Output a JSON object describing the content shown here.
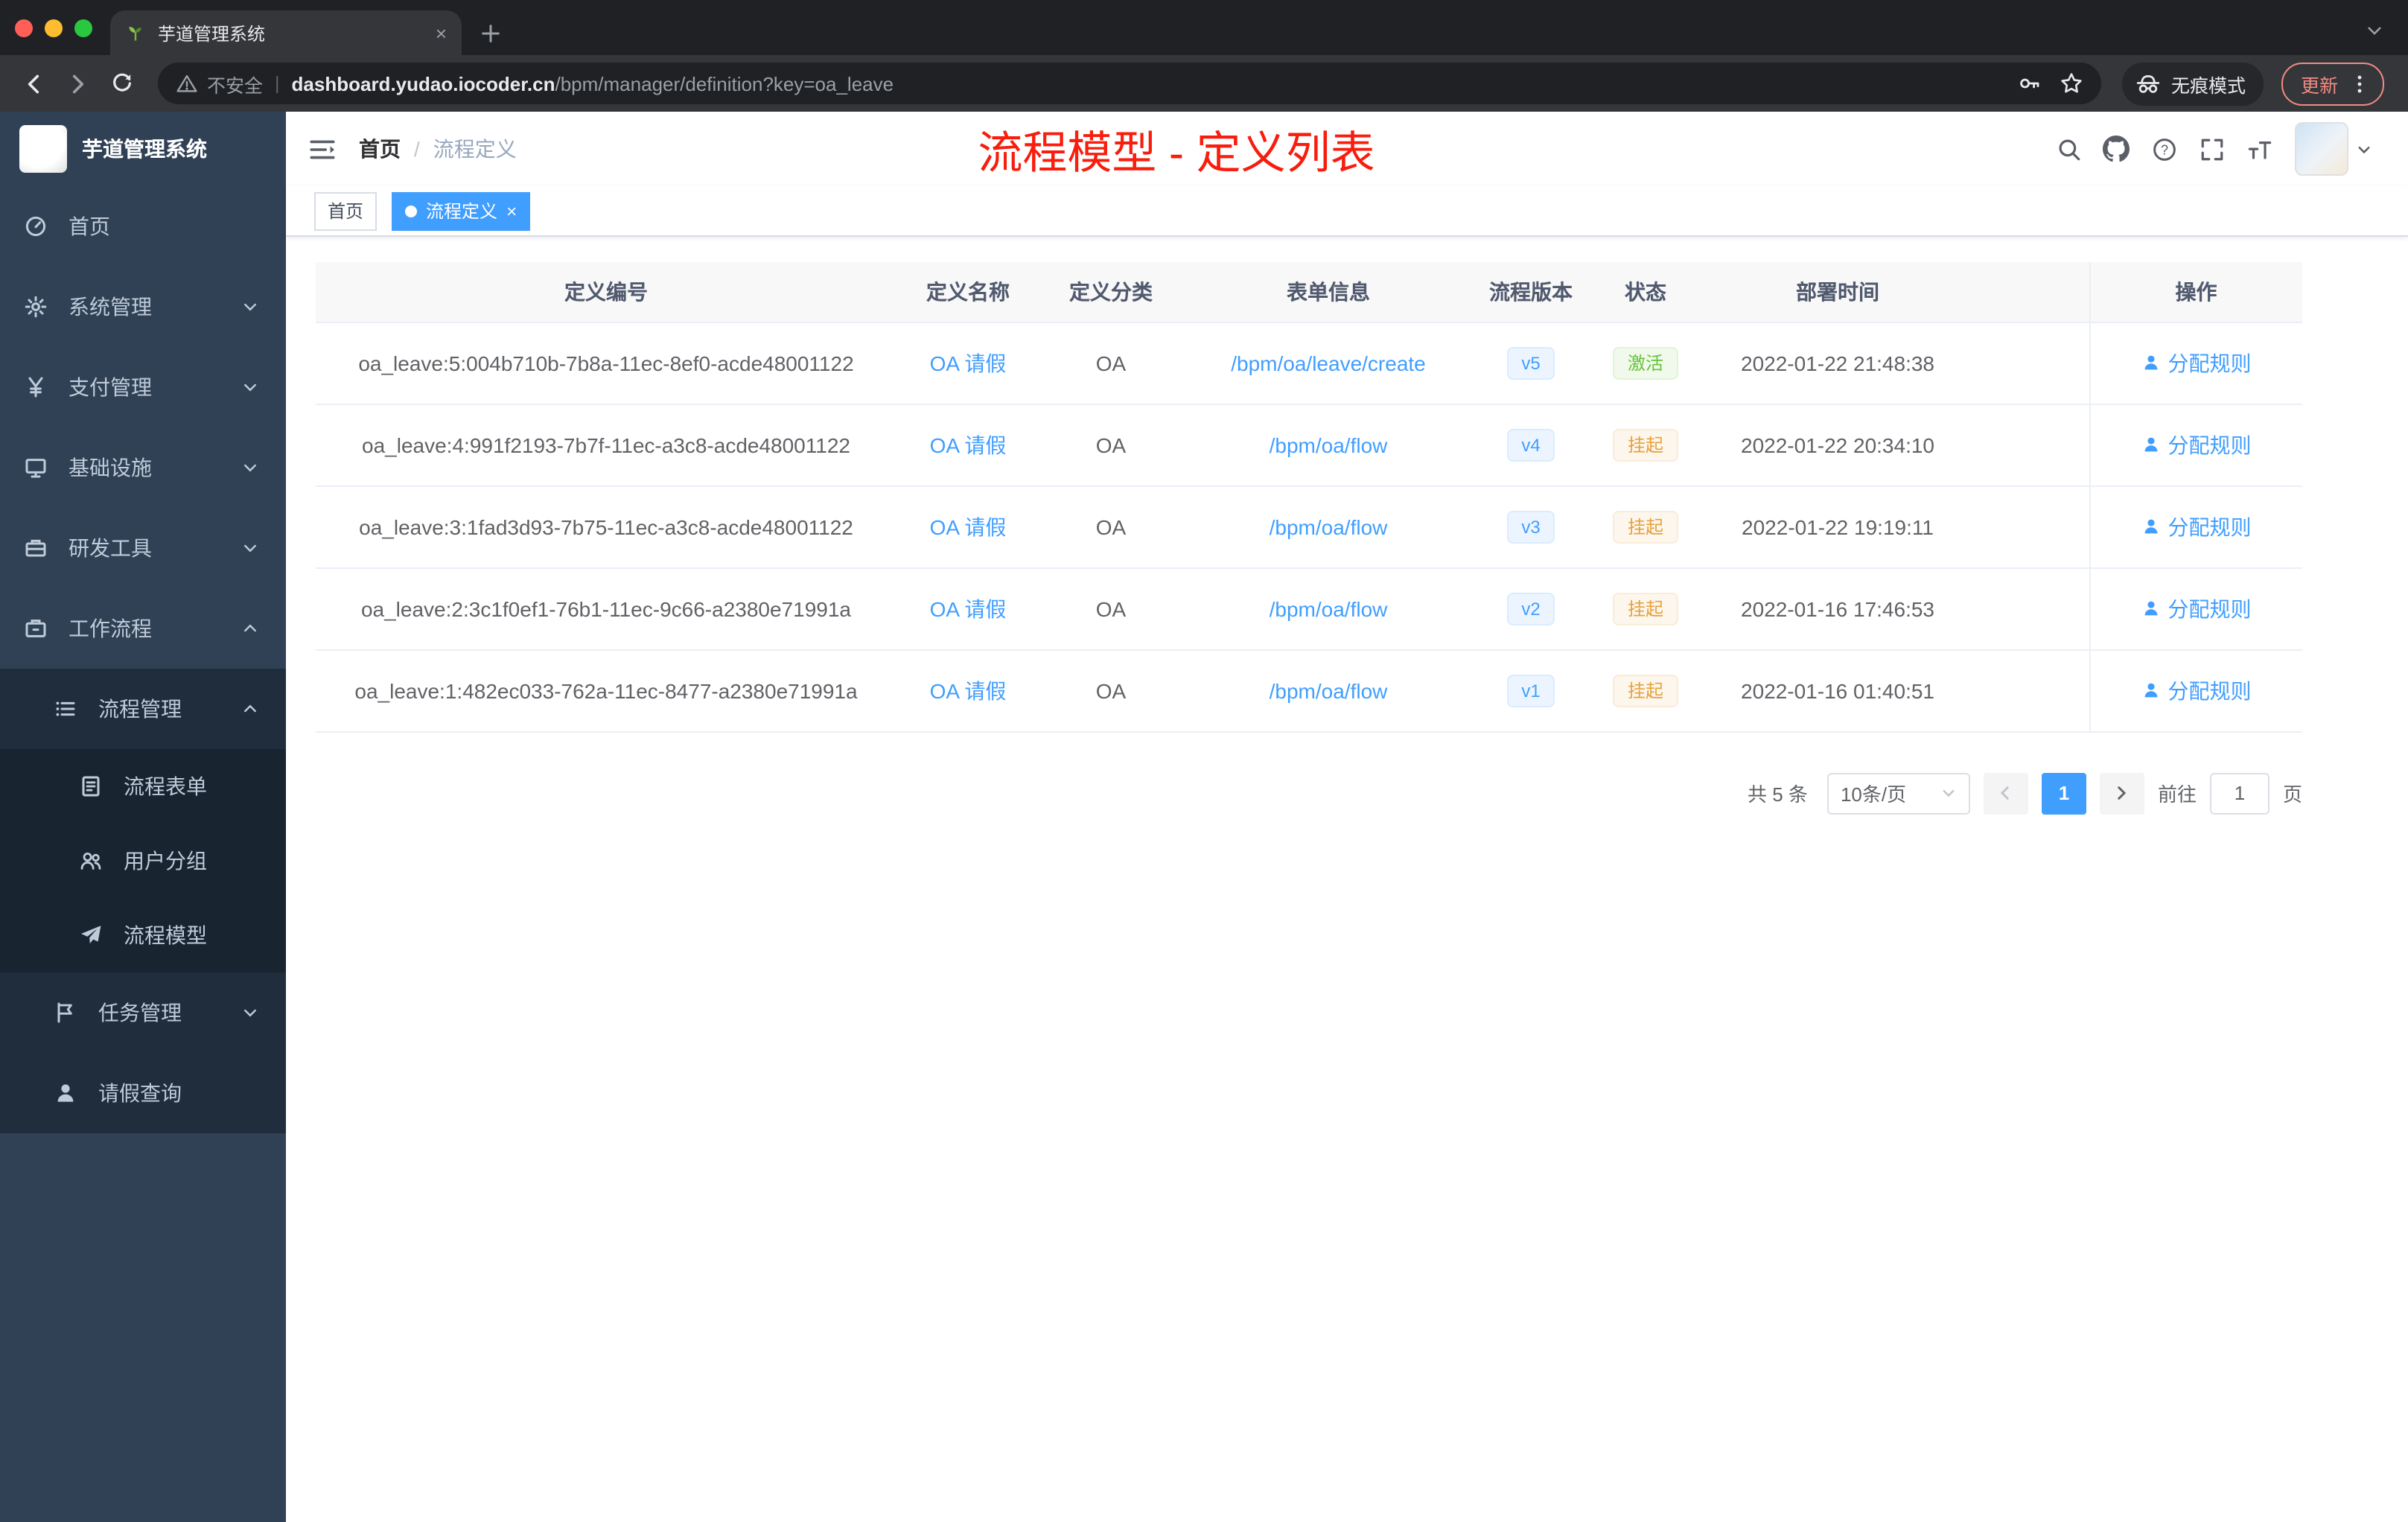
{
  "colors": {
    "accent_blue": "#409eff",
    "success_green": "#67c23a",
    "warning_orange": "#e6a23c",
    "annotation_red": "#f81d0d",
    "sidebar_bg": "#304156",
    "active_tag_bg": "#409eff"
  },
  "browser": {
    "tab": {
      "title": "芋道管理系统",
      "close_glyph": "×"
    },
    "security_label": "不安全",
    "url_domain": "dashboard.yudao.iocoder.cn",
    "url_path": "/bpm/manager/definition?key=oa_leave",
    "incognito_label": "无痕模式",
    "update_label": "更新"
  },
  "sidebar": {
    "logo_title": "芋道管理系统",
    "items": [
      {
        "label": "首页"
      },
      {
        "label": "系统管理"
      },
      {
        "label": "支付管理"
      },
      {
        "label": "基础设施"
      },
      {
        "label": "研发工具"
      },
      {
        "label": "工作流程"
      },
      {
        "label": "流程管理"
      },
      {
        "label": "流程表单"
      },
      {
        "label": "用户分组"
      },
      {
        "label": "流程模型"
      },
      {
        "label": "任务管理"
      },
      {
        "label": "请假查询"
      }
    ]
  },
  "header": {
    "breadcrumb": {
      "home": "首页",
      "separator": "/",
      "current": "流程定义"
    },
    "annotation": "流程模型 - 定义列表"
  },
  "tags": {
    "inactive": "首页",
    "active": "流程定义",
    "close_glyph": "×"
  },
  "table": {
    "columns": [
      "定义编号",
      "定义名称",
      "定义分类",
      "表单信息",
      "流程版本",
      "状态",
      "部署时间",
      "操作"
    ],
    "rows": [
      {
        "id": "oa_leave:5:004b710b-7b8a-11ec-8ef0-acde48001122",
        "name": "OA 请假",
        "category": "OA",
        "form": "/bpm/oa/leave/create",
        "version": "v5",
        "status": "激活",
        "time": "2022-01-22 21:48:38",
        "action": "分配规则"
      },
      {
        "id": "oa_leave:4:991f2193-7b7f-11ec-a3c8-acde48001122",
        "name": "OA 请假",
        "category": "OA",
        "form": "/bpm/oa/flow",
        "version": "v4",
        "status": "挂起",
        "time": "2022-01-22 20:34:10",
        "action": "分配规则"
      },
      {
        "id": "oa_leave:3:1fad3d93-7b75-11ec-a3c8-acde48001122",
        "name": "OA 请假",
        "category": "OA",
        "form": "/bpm/oa/flow",
        "version": "v3",
        "status": "挂起",
        "time": "2022-01-22 19:19:11",
        "action": "分配规则"
      },
      {
        "id": "oa_leave:2:3c1f0ef1-76b1-11ec-9c66-a2380e71991a",
        "name": "OA 请假",
        "category": "OA",
        "form": "/bpm/oa/flow",
        "version": "v2",
        "status": "挂起",
        "time": "2022-01-16 17:46:53",
        "action": "分配规则"
      },
      {
        "id": "oa_leave:1:482ec033-762a-11ec-8477-a2380e71991a",
        "name": "OA 请假",
        "category": "OA",
        "form": "/bpm/oa/flow",
        "version": "v1",
        "status": "挂起",
        "time": "2022-01-16 01:40:51",
        "action": "分配规则"
      }
    ]
  },
  "pagination": {
    "total": "共 5 条",
    "page_size": "10条/页",
    "current_page": "1",
    "goto_label": "前往",
    "goto_value": "1",
    "page_unit": "页"
  }
}
